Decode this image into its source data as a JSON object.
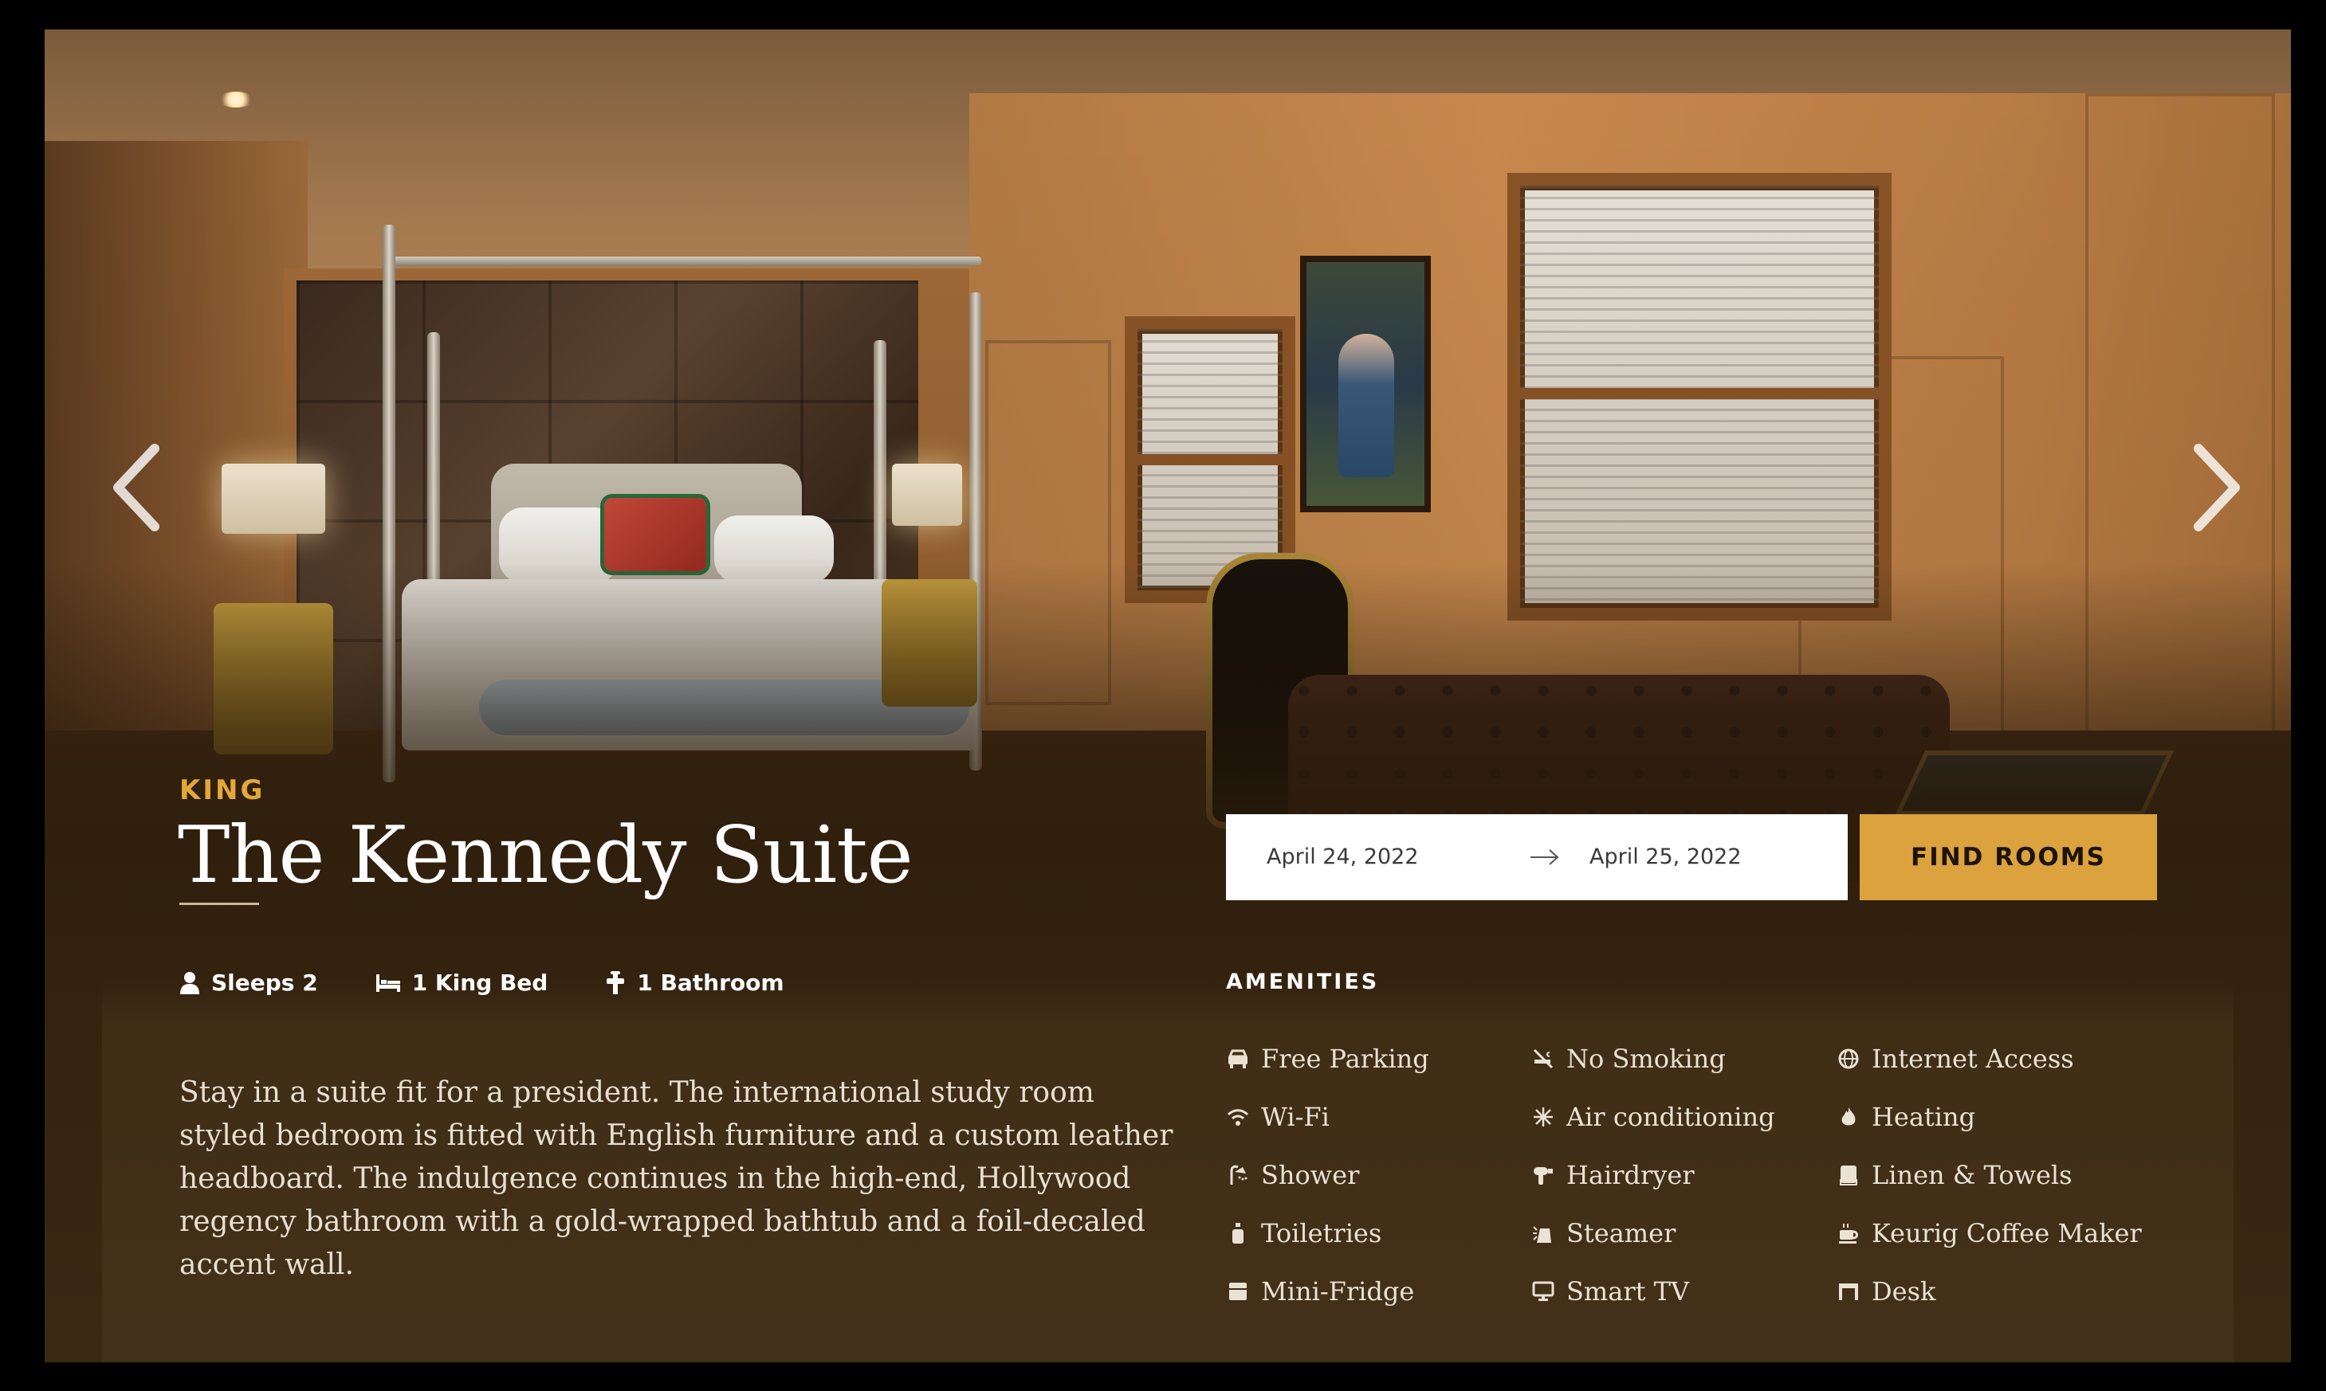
{
  "room": {
    "type": "KING",
    "title": "The Kennedy Suite",
    "features": [
      {
        "icon": "person-icon",
        "label": "Sleeps 2"
      },
      {
        "icon": "bed-icon",
        "label": "1 King Bed"
      },
      {
        "icon": "faucet-icon",
        "label": "1 Bathroom"
      }
    ],
    "description": "Stay in a suite fit for a president. The international study room styled bedroom is fitted with English furniture and a custom leather headboard. The indulgence continues in the high-end, Hollywood regency bathroom with a gold-wrapped bathtub and a foil-decaled accent wall."
  },
  "booking": {
    "check_in": "April 24, 2022",
    "check_out": "April 25, 2022",
    "button_label": "FIND ROOMS"
  },
  "amenities": {
    "heading": "AMENITIES",
    "items": [
      {
        "icon": "car-icon",
        "label": "Free Parking"
      },
      {
        "icon": "no-smoking-icon",
        "label": "No Smoking"
      },
      {
        "icon": "globe-icon",
        "label": "Internet Access"
      },
      {
        "icon": "wifi-icon",
        "label": "Wi-Fi"
      },
      {
        "icon": "snowflake-icon",
        "label": "Air conditioning"
      },
      {
        "icon": "flame-icon",
        "label": "Heating"
      },
      {
        "icon": "shower-icon",
        "label": "Shower"
      },
      {
        "icon": "hairdryer-icon",
        "label": "Hairdryer"
      },
      {
        "icon": "towel-icon",
        "label": "Linen & Towels"
      },
      {
        "icon": "bottle-icon",
        "label": "Toiletries"
      },
      {
        "icon": "steamer-icon",
        "label": "Steamer"
      },
      {
        "icon": "coffee-icon",
        "label": "Keurig Coffee Maker"
      },
      {
        "icon": "fridge-icon",
        "label": "Mini-Fridge"
      },
      {
        "icon": "tv-icon",
        "label": "Smart TV"
      },
      {
        "icon": "desk-icon",
        "label": "Desk"
      }
    ]
  },
  "colors": {
    "accent": "#dca23e",
    "room_type": "#e2a93a",
    "panel": "#3f2e16"
  }
}
